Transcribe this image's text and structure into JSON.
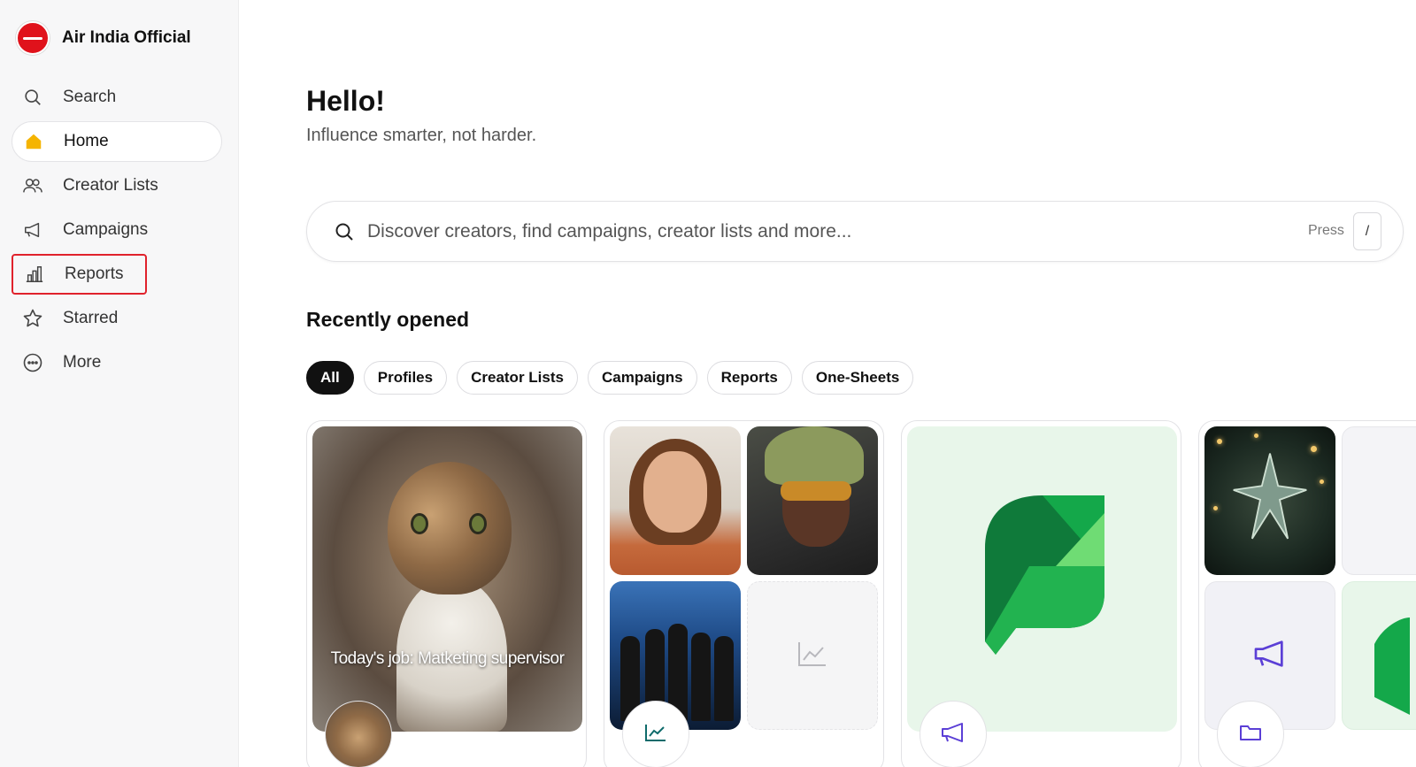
{
  "brand": {
    "name": "Air India Official",
    "logo_color": "#e0121b"
  },
  "sidebar": {
    "items": [
      {
        "label": "Search",
        "icon": "search-icon"
      },
      {
        "label": "Home",
        "icon": "home-icon",
        "active": true
      },
      {
        "label": "Creator Lists",
        "icon": "users-icon"
      },
      {
        "label": "Campaigns",
        "icon": "megaphone-icon"
      },
      {
        "label": "Reports",
        "icon": "bar-chart-icon",
        "highlighted": true
      },
      {
        "label": "Starred",
        "icon": "star-icon"
      },
      {
        "label": "More",
        "icon": "more-icon"
      }
    ]
  },
  "main": {
    "greeting": "Hello!",
    "subtitle": "Influence smarter, not harder.",
    "search": {
      "placeholder": "Discover creators, find campaigns, creator lists and more...",
      "shortcut_hint": "Press",
      "shortcut_key": "/"
    },
    "recent_title": "Recently opened",
    "filters": [
      "All",
      "Profiles",
      "Creator Lists",
      "Campaigns",
      "Reports",
      "One-Sheets"
    ],
    "active_filter": "All",
    "cards": [
      {
        "caption": "Today's job: Matketing supervisor"
      }
    ]
  },
  "colors": {
    "accent_home": "#f5b400",
    "highlight_border": "#e0222c",
    "green_dark": "#0f7a3a",
    "green_light": "#6fdc74",
    "purple_icon": "#5b3fd6"
  }
}
